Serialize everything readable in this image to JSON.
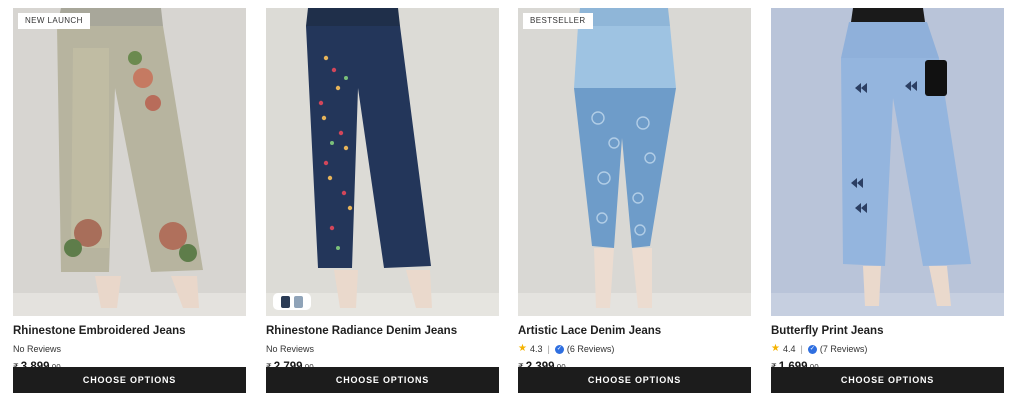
{
  "products": [
    {
      "badge": "NEW LAUNCH",
      "title": "Rhinestone Embroidered Jeans",
      "reviews_text": "No Reviews",
      "currency": "₹",
      "price_main": "3,899",
      "price_decimal": ".00",
      "cta": "CHOOSE OPTIONS"
    },
    {
      "title": "Rhinestone Radiance Denim Jeans",
      "reviews_text": "No Reviews",
      "currency": "₹",
      "price_main": "2,799",
      "price_decimal": ".00",
      "cta": "CHOOSE OPTIONS",
      "swatch_colors": [
        "#2a3b55",
        "#8fa3b8"
      ]
    },
    {
      "badge": "BESTSELLER",
      "title": "Artistic Lace Denim Jeans",
      "rating": "4.3",
      "reviews_text": "(6 Reviews)",
      "currency": "₹",
      "price_main": "2,399",
      "price_decimal": ".00",
      "cta": "CHOOSE OPTIONS"
    },
    {
      "title": "Butterfly Print Jeans",
      "rating": "4.4",
      "reviews_text": "(7 Reviews)",
      "currency": "₹",
      "price_main": "1,699",
      "price_decimal": ".00",
      "cta": "CHOOSE OPTIONS"
    }
  ],
  "colors": {
    "button_bg": "#1c1c1c",
    "star": "#f5b301",
    "verified": "#2f6fe0"
  }
}
